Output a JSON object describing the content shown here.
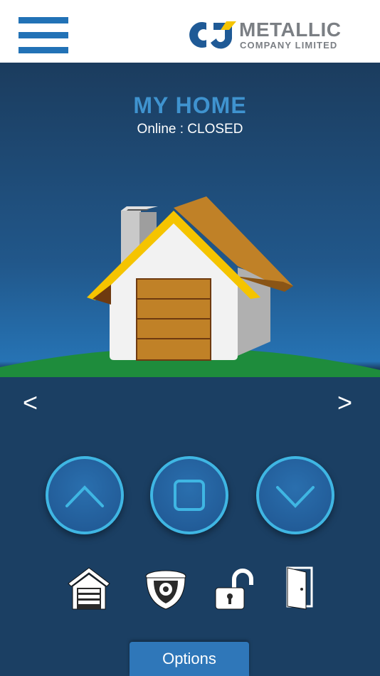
{
  "header": {
    "menu_icon": "hamburger-menu-icon",
    "logo_title": "METALLIC",
    "logo_subtitle": "COMPANY LIMITED",
    "logo_mark": "CJ"
  },
  "device": {
    "name": "MY HOME",
    "status": "Online : CLOSED"
  },
  "nav": {
    "prev_label": "<",
    "next_label": ">"
  },
  "controls": [
    {
      "icon": "chevron-up-icon"
    },
    {
      "icon": "stop-square-icon"
    },
    {
      "icon": "chevron-down-icon"
    }
  ],
  "tools": [
    {
      "icon": "garage-icon"
    },
    {
      "icon": "security-camera-icon"
    },
    {
      "icon": "unlock-icon"
    },
    {
      "icon": "door-icon"
    }
  ],
  "options_label": "Options",
  "colors": {
    "brand_blue": "#2272b6",
    "accent_cyan": "#3fb6e3",
    "title_blue": "#3f93cf",
    "logo_gray": "#7b7f84",
    "logo_yellow": "#f5c400"
  }
}
